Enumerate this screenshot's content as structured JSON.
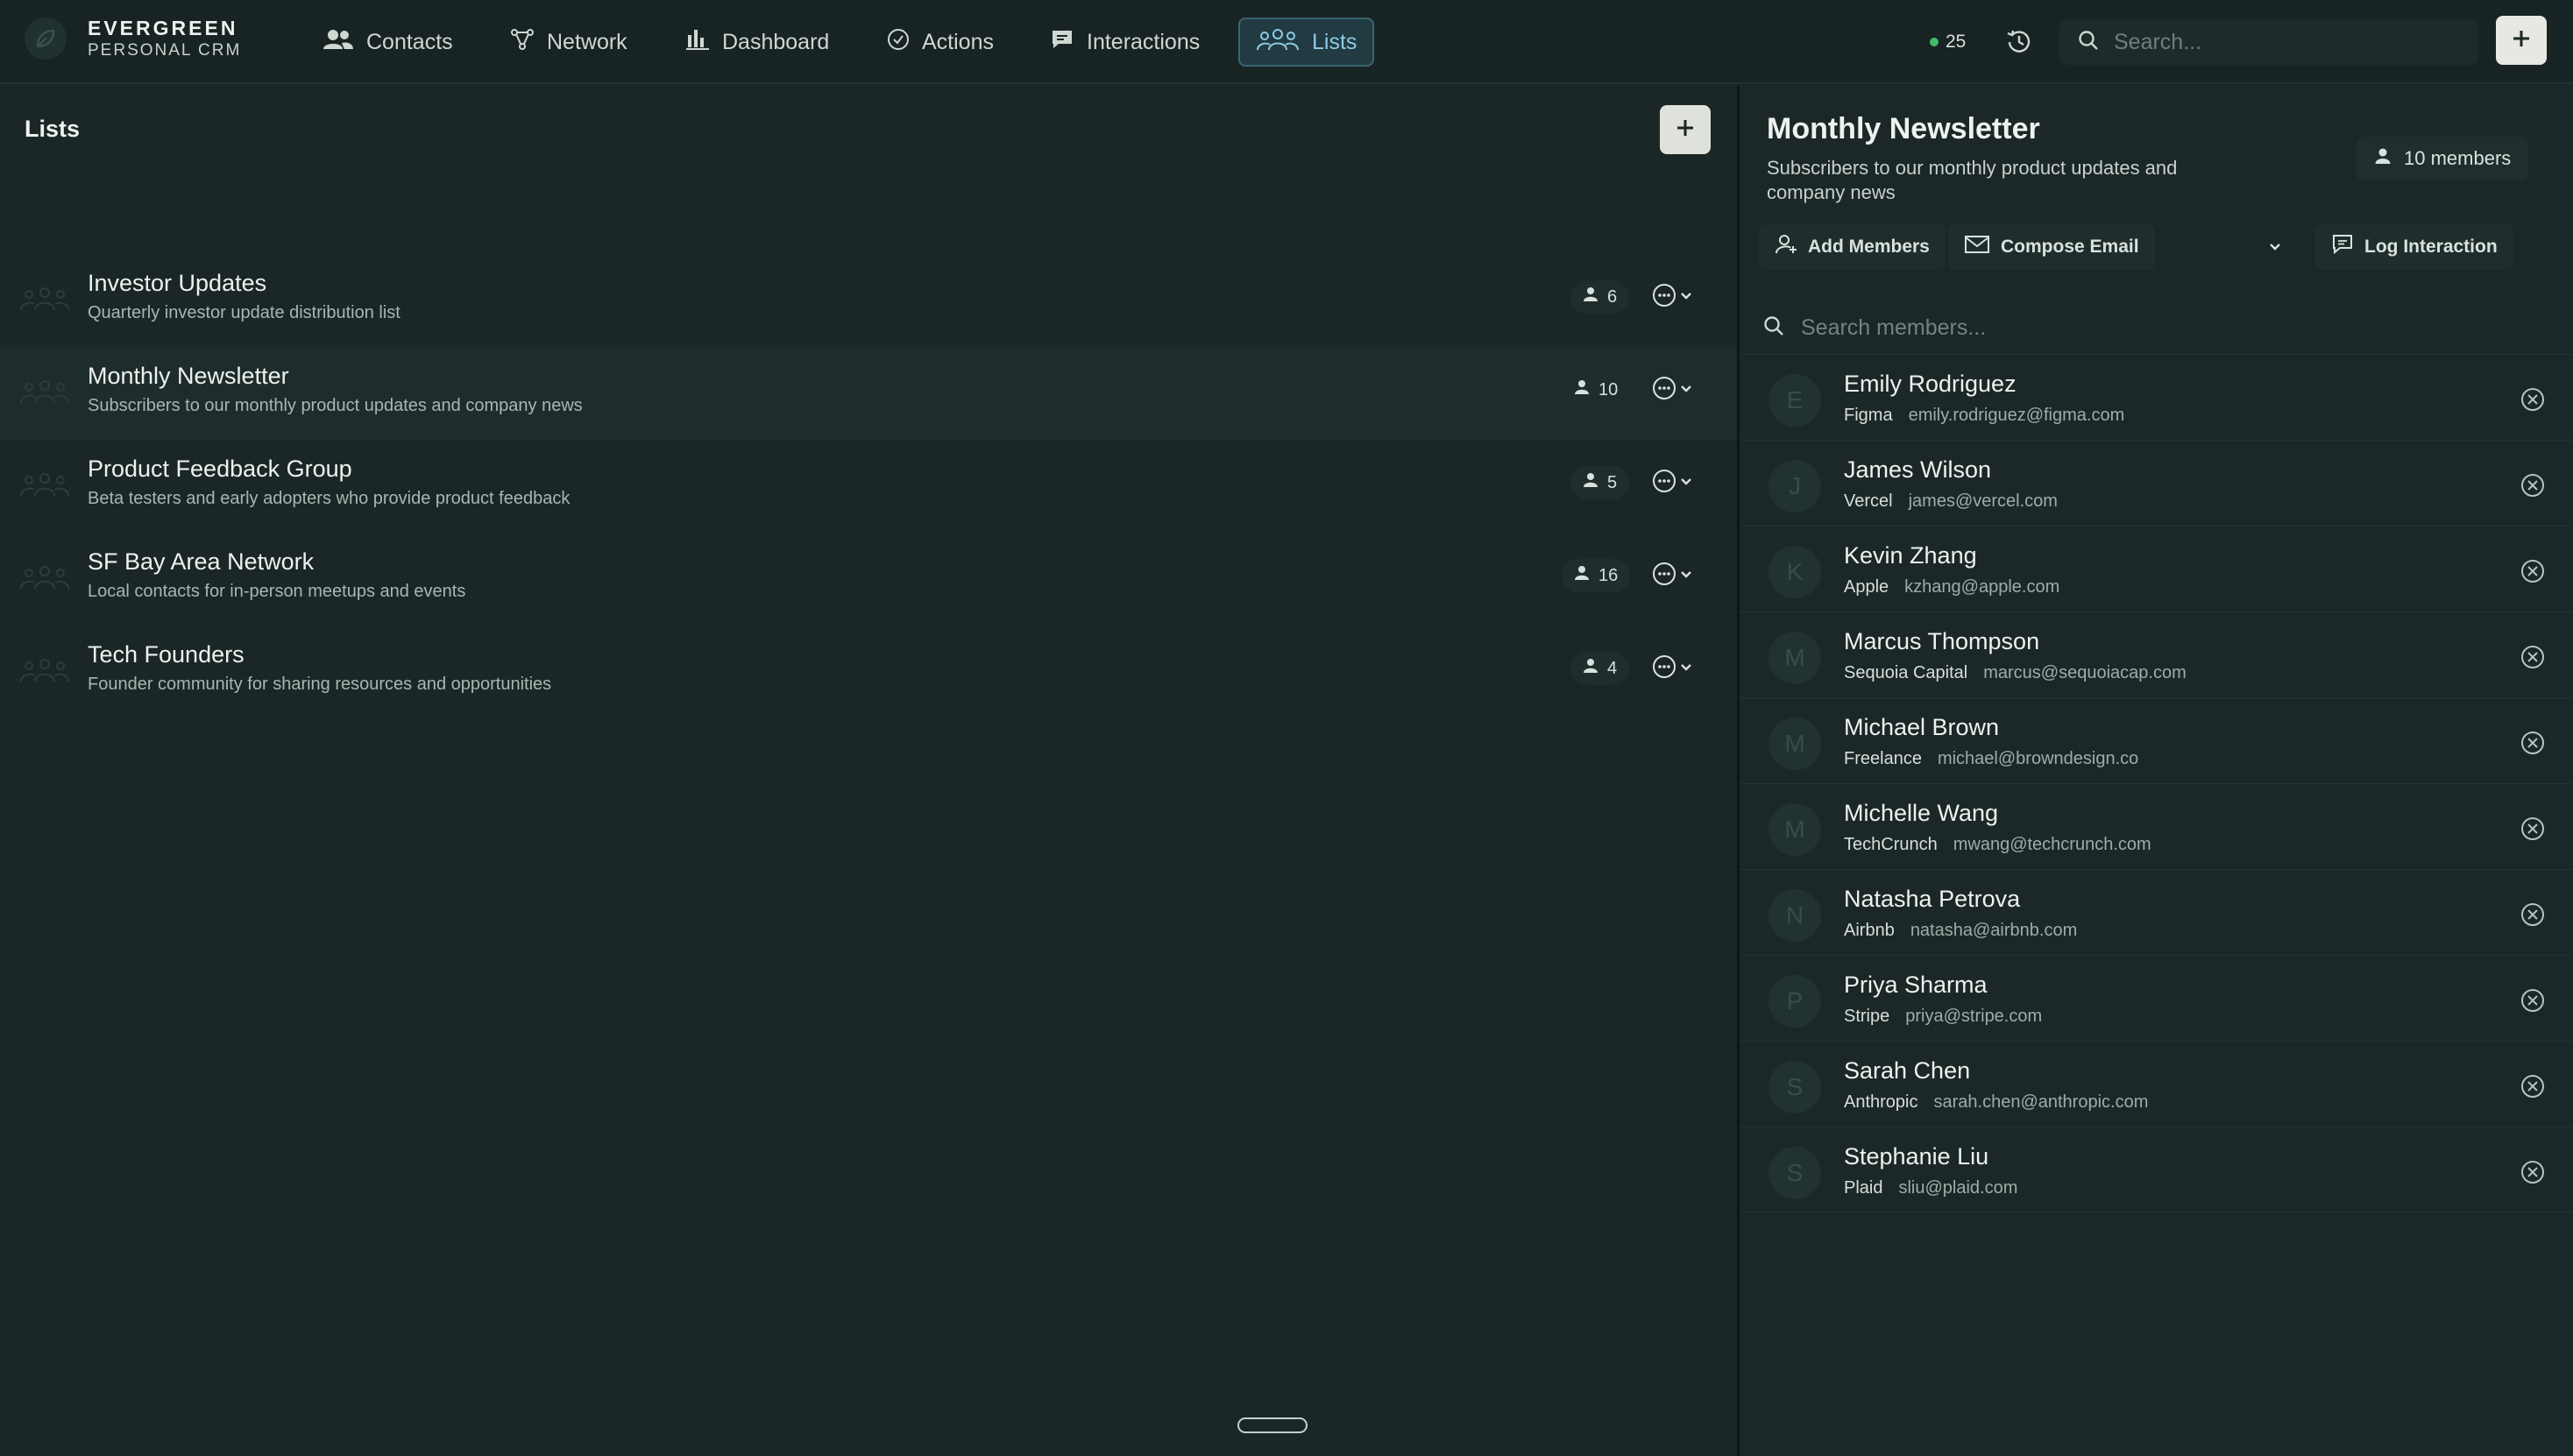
{
  "app": {
    "name": "EVERGREEN",
    "subtitle": "PERSONAL CRM"
  },
  "nav": {
    "items": [
      {
        "label": "Contacts",
        "icon": "users-icon"
      },
      {
        "label": "Network",
        "icon": "network-icon"
      },
      {
        "label": "Dashboard",
        "icon": "bar-chart-icon"
      },
      {
        "label": "Actions",
        "icon": "check-circle-icon"
      },
      {
        "label": "Interactions",
        "icon": "message-icon"
      },
      {
        "label": "Lists",
        "icon": "group-icon",
        "active": true
      }
    ]
  },
  "topbar": {
    "status_count": "25",
    "status_color": "#3fbf6b",
    "search_placeholder": "Search..."
  },
  "lists_panel": {
    "title": "Lists",
    "lists": [
      {
        "name": "Investor Updates",
        "description": "Quarterly investor update distribution list",
        "count": "6"
      },
      {
        "name": "Monthly Newsletter",
        "description": "Subscribers to our monthly product updates and company news",
        "count": "10",
        "selected": true
      },
      {
        "name": "Product Feedback Group",
        "description": "Beta testers and early adopters who provide product feedback",
        "count": "5"
      },
      {
        "name": "SF Bay Area Network",
        "description": "Local contacts for in-person meetups and events",
        "count": "16"
      },
      {
        "name": "Tech Founders",
        "description": "Founder community for sharing resources and opportunities",
        "count": "4"
      }
    ]
  },
  "detail": {
    "title": "Monthly Newsletter",
    "description": "Subscribers to our monthly product updates and company news",
    "members_badge": "10 members",
    "add_members_label": "Add Members",
    "compose_email_label": "Compose Email",
    "log_interaction_label": "Log Interaction",
    "member_search_placeholder": "Search members...",
    "members": [
      {
        "initial": "E",
        "name": "Emily Rodriguez",
        "company": "Figma",
        "email": "emily.rodriguez@figma.com"
      },
      {
        "initial": "J",
        "name": "James Wilson",
        "company": "Vercel",
        "email": "james@vercel.com"
      },
      {
        "initial": "K",
        "name": "Kevin Zhang",
        "company": "Apple",
        "email": "kzhang@apple.com"
      },
      {
        "initial": "M",
        "name": "Marcus Thompson",
        "company": "Sequoia Capital",
        "email": "marcus@sequoiacap.com"
      },
      {
        "initial": "M",
        "name": "Michael Brown",
        "company": "Freelance",
        "email": "michael@browndesign.co"
      },
      {
        "initial": "M",
        "name": "Michelle Wang",
        "company": "TechCrunch",
        "email": "mwang@techcrunch.com"
      },
      {
        "initial": "N",
        "name": "Natasha Petrova",
        "company": "Airbnb",
        "email": "natasha@airbnb.com"
      },
      {
        "initial": "P",
        "name": "Priya Sharma",
        "company": "Stripe",
        "email": "priya@stripe.com"
      },
      {
        "initial": "S",
        "name": "Sarah Chen",
        "company": "Anthropic",
        "email": "sarah.chen@anthropic.com"
      },
      {
        "initial": "S",
        "name": "Stephanie Liu",
        "company": "Plaid",
        "email": "sliu@plaid.com"
      }
    ]
  },
  "colors": {
    "background": "#1a2726",
    "accent": "#8ccbe6",
    "accent_bg": "#223a41"
  }
}
